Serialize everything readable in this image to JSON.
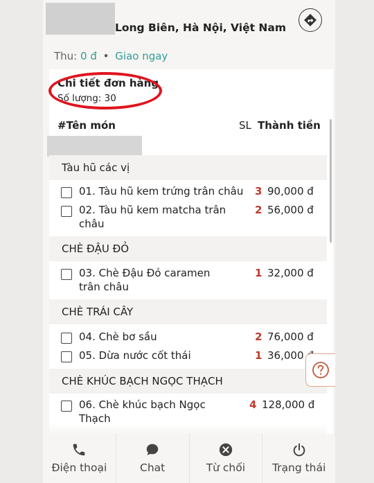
{
  "header": {
    "address": "Long Biên, Hà Nội, Việt Nam",
    "thu_label": "Thu:",
    "thu_value": "0 đ",
    "delivery": "Giao ngay"
  },
  "order": {
    "title": "Chi tiết đơn hàng",
    "quantity": "Số lượng: 30",
    "col_name": "#Tên món",
    "col_sl": "SL",
    "col_total": "Thành tiền"
  },
  "categories": [
    {
      "label": "Tàu hũ các vị"
    },
    {
      "label": "CHÈ ĐẬU ĐỎ"
    },
    {
      "label": "CHÈ TRÁI CÂY"
    },
    {
      "label": "CHÈ KHÚC BẠCH NGỌC THẠCH"
    }
  ],
  "items": [
    {
      "name": "01. Tàu hũ kem trứng trân châu",
      "qty": "3",
      "price": "90,000 đ"
    },
    {
      "name": "02. Tàu hũ kem matcha trân châu",
      "qty": "2",
      "price": "56,000 đ"
    },
    {
      "name": "03. Chè Đậu Đỏ caramen trân châu",
      "qty": "1",
      "price": "32,000 đ"
    },
    {
      "name": "04. Chè bơ sầu",
      "qty": "2",
      "price": "76,000 đ"
    },
    {
      "name": "05. Dừa nước cốt thái",
      "qty": "1",
      "price": "36,000 đ"
    },
    {
      "name": "06. Chè khúc bạch Ngọc Thạch",
      "qty": "4",
      "price": "128,000 đ"
    }
  ],
  "bottom_bar": [
    {
      "label": "Điện thoại",
      "icon": "phone-icon"
    },
    {
      "label": "Chat",
      "icon": "chat-icon"
    },
    {
      "label": "Từ chối",
      "icon": "reject-icon"
    },
    {
      "label": "Trạng thái",
      "icon": "power-icon"
    }
  ],
  "colors": {
    "teal": "#2f9e94",
    "qty_red": "#c0392b",
    "annotation_red": "#e0141e"
  }
}
